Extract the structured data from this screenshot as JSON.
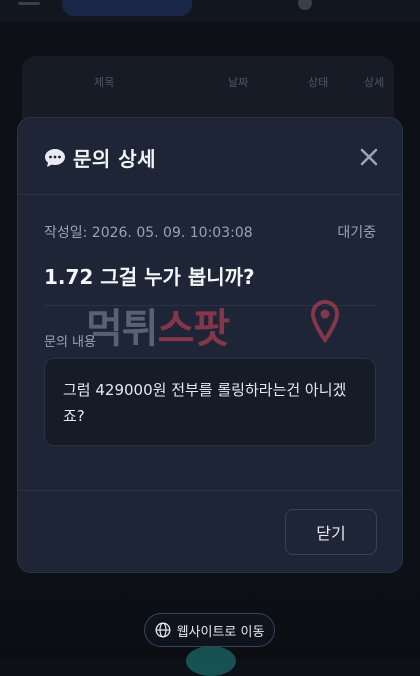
{
  "background": {
    "table_headers": [
      "제목",
      "날짜",
      "상태",
      "상세"
    ]
  },
  "modal": {
    "title": "문의 상세",
    "date_label": "작성일: 2026. 05. 09. 10:03:08",
    "status": "대기중",
    "inquiry_title": "1.72 그걸 누가 봅니까?",
    "content_label": "문의 내용",
    "content_text": "그럼 429000원 전부를 롤링하라는건 아니겠죠?",
    "close_button_label": "닫기"
  },
  "watermark": {
    "part1": "먹튀",
    "part2": "스팟"
  },
  "footer": {
    "website_link_label": "웹사이트로 이동"
  },
  "icons": {
    "chat": "chat-bubble-icon",
    "close": "close-icon",
    "globe": "globe-icon",
    "pin": "location-pin-icon"
  },
  "colors": {
    "modal_bg": "#1d2536",
    "watermark_red": "#d9465a",
    "text_primary": "#f1f3f7",
    "text_muted": "#9aa3b3"
  }
}
